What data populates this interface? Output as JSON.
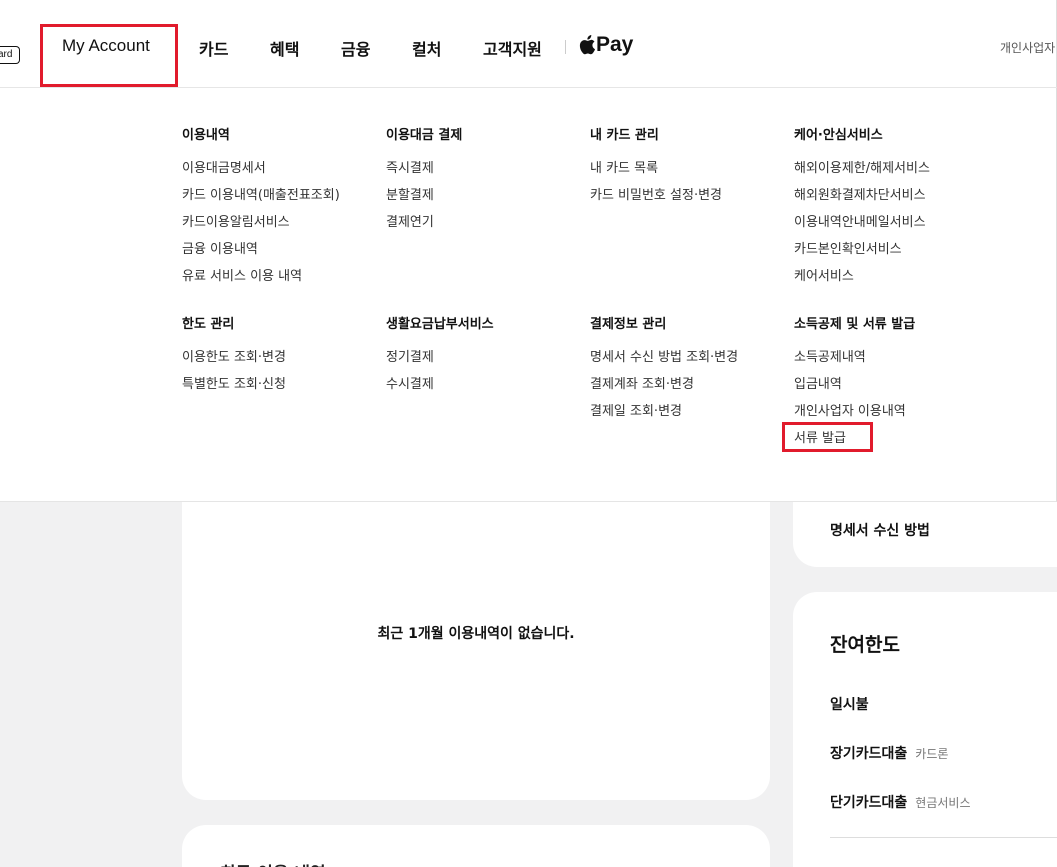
{
  "header": {
    "logo_fragment": "ard",
    "nav": {
      "my_account": "My Account",
      "card": "카드",
      "benefit": "혜택",
      "finance": "금융",
      "culture": "컬처",
      "support": "고객지원",
      "pay": "Pay",
      "right_link": "개인사업자"
    }
  },
  "mega_menu": {
    "row1": [
      {
        "title": "이용내역",
        "items": [
          "이용대금명세서",
          "카드 이용내역(매출전표조회)",
          "카드이용알림서비스",
          "금융 이용내역",
          "유료 서비스 이용 내역"
        ]
      },
      {
        "title": "이용대금 결제",
        "items": [
          "즉시결제",
          "분할결제",
          "결제연기"
        ]
      },
      {
        "title": "내 카드 관리",
        "items": [
          "내 카드 목록",
          "카드 비밀번호 설정·변경"
        ]
      },
      {
        "title": "케어·안심서비스",
        "items": [
          "해외이용제한/해제서비스",
          "해외원화결제차단서비스",
          "이용내역안내메일서비스",
          "카드본인확인서비스",
          "케어서비스"
        ]
      }
    ],
    "row2": [
      {
        "title": "한도 관리",
        "items": [
          "이용한도 조회·변경",
          "특별한도 조회·신청"
        ]
      },
      {
        "title": "생활요금납부서비스",
        "items": [
          "정기결제",
          "수시결제"
        ]
      },
      {
        "title": "결제정보 관리",
        "items": [
          "명세서 수신 방법 조회·변경",
          "결제계좌 조회·변경",
          "결제일 조회·변경"
        ]
      },
      {
        "title": "소득공제 및 서류 발급",
        "items": [
          "소득공제내역",
          "입금내역",
          "개인사업자 이용내역",
          "서류 발급"
        ]
      }
    ]
  },
  "background": {
    "empty_message": "최근 1개월 이용내역이 없습니다.",
    "bottom_card_partial": "최근 이용 내역",
    "side_link": "명세서 수신 방법",
    "limit": {
      "title": "잔여한도",
      "rows": [
        {
          "label": "일시불",
          "sub": ""
        },
        {
          "label": "장기카드대출",
          "sub": "카드론"
        },
        {
          "label": "단기카드대출",
          "sub": "현금서비스"
        }
      ]
    }
  },
  "colors": {
    "highlight": "#e11b2c",
    "page_bg": "#f1f1f2"
  },
  "icons": {
    "pay_logo": "apple-icon"
  }
}
